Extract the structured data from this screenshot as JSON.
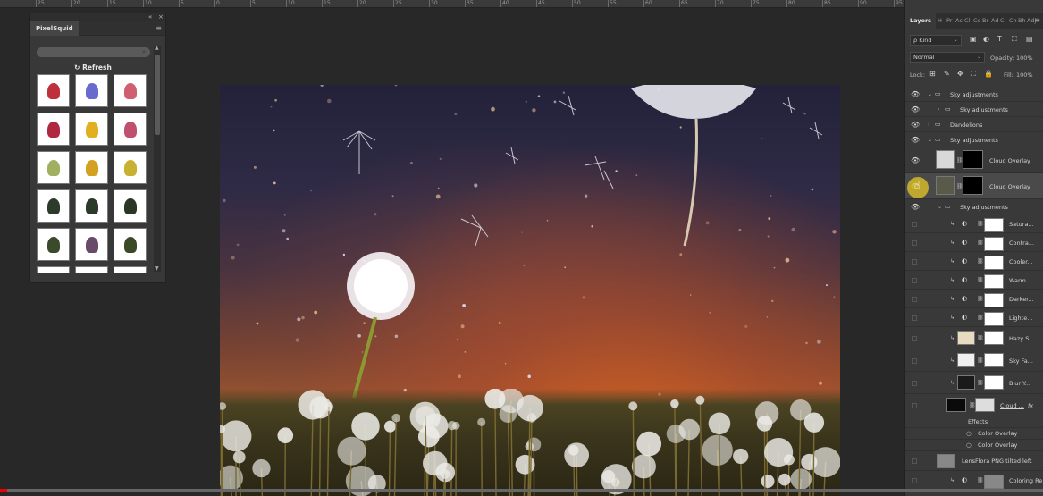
{
  "ruler": {
    "labels": [
      "25",
      "20",
      "15",
      "10",
      "5",
      "0",
      "5",
      "10",
      "15",
      "20",
      "25",
      "30",
      "35",
      "40",
      "45",
      "50",
      "55",
      "60",
      "65",
      "70",
      "75",
      "80",
      "85",
      "90",
      "95",
      "100"
    ]
  },
  "pixelsquid": {
    "tab": "PixelSquid",
    "collapse_icon": "double-chevron-icon",
    "close_glyph": "×",
    "menu_glyph": "≡",
    "search_glyph": "⌕",
    "refresh_label": "Refresh",
    "refresh_icon": "refresh-icon",
    "thumbnails": [
      {
        "name": "red-rose",
        "color": "#c0303a"
      },
      {
        "name": "blue-flower",
        "color": "#6a6acc"
      },
      {
        "name": "pink-flower",
        "color": "#d06070"
      },
      {
        "name": "red-flowers",
        "color": "#b02840"
      },
      {
        "name": "yellow-flower",
        "color": "#e0b020"
      },
      {
        "name": "pink-branch",
        "color": "#c05070"
      },
      {
        "name": "white-flower",
        "color": "#a0b060"
      },
      {
        "name": "sunflowers",
        "color": "#d4a020"
      },
      {
        "name": "yellow-branch",
        "color": "#c8b030"
      },
      {
        "name": "tree-1",
        "color": "#2e3a2a"
      },
      {
        "name": "tree-2",
        "color": "#2c3a28"
      },
      {
        "name": "tree-3",
        "color": "#2a3626"
      },
      {
        "name": "shrub",
        "color": "#3a4a2a"
      },
      {
        "name": "purple-shrub",
        "color": "#6a4a6a"
      },
      {
        "name": "grass-tuft",
        "color": "#3a4a28"
      },
      {
        "name": "more-1",
        "color": "#555555"
      },
      {
        "name": "more-2",
        "color": "#c08040"
      },
      {
        "name": "more-3",
        "color": "#555555"
      }
    ]
  },
  "panel": {
    "tabs": [
      "Layers",
      "H",
      "Pr",
      "Ac",
      "Cl",
      "Cc",
      "Br",
      "Ad",
      "Cl",
      "Ch",
      "Bh",
      "Adj"
    ],
    "menu_glyph": "≡",
    "filter_kind": "ρ Kind",
    "blend_mode": "Normal",
    "opacity_label": "Opacity:",
    "opacity_value": "100%",
    "lock_label": "Lock:",
    "fill_label": "Fill:",
    "fill_value": "100%",
    "caret": "⌄"
  },
  "layers": [
    {
      "name": "Sky adjustments",
      "kind": "group",
      "indent": 0,
      "expanded": true,
      "visible": true
    },
    {
      "name": "Sky adjustments",
      "kind": "group",
      "indent": 1,
      "expanded": false,
      "visible": true
    },
    {
      "name": "Dandelions",
      "kind": "group",
      "indent": 0,
      "expanded": false,
      "visible": true
    },
    {
      "name": "Sky adjustments",
      "kind": "group",
      "indent": 0,
      "expanded": true,
      "visible": true
    },
    {
      "name": "Cloud Overlay",
      "kind": "layer-mask",
      "indent": 1,
      "visible": true,
      "thumb": "#d8d8d8",
      "mask": "#000000"
    },
    {
      "name": "Cloud Overlay",
      "kind": "layer-mask",
      "indent": 1,
      "visible": true,
      "selected": true,
      "thumb": "#5a5a4a",
      "mask": "#000000"
    },
    {
      "name": "Sky adjustments",
      "kind": "group",
      "indent": 1,
      "expanded": true,
      "visible": true
    },
    {
      "name": "Satura...",
      "kind": "adjust",
      "visible": false,
      "mask": "#ffffff"
    },
    {
      "name": "Contra...",
      "kind": "adjust",
      "visible": false,
      "mask": "#ffffff"
    },
    {
      "name": "Cooler...",
      "kind": "adjust",
      "visible": false,
      "mask": "#ffffff"
    },
    {
      "name": "Warm...",
      "kind": "adjust",
      "visible": false,
      "mask": "#ffffff"
    },
    {
      "name": "Darker...",
      "kind": "adjust",
      "visible": false,
      "mask": "#ffffff"
    },
    {
      "name": "Lighte...",
      "kind": "adjust",
      "visible": false,
      "mask": "#ffffff"
    },
    {
      "name": "Hazy S...",
      "kind": "fill",
      "visible": false,
      "thumb": "#e8dcc0",
      "mask": "#ffffff"
    },
    {
      "name": "Sky Fa...",
      "kind": "fill",
      "visible": false,
      "thumb": "#f0f0f0",
      "mask": "#ffffff"
    },
    {
      "name": "Blur Y...",
      "kind": "fill",
      "visible": false,
      "thumb": "#1a1a1a",
      "mask": "#ffffff"
    },
    {
      "name": "Cloud ...",
      "kind": "fx",
      "visible": false,
      "thumb": "#0a0a0a",
      "mask": "#dddddd",
      "fx": "fx"
    },
    {
      "name": "Effects",
      "kind": "effects-header",
      "visible": false
    },
    {
      "name": "Color Overlay",
      "kind": "effect",
      "visible": false
    },
    {
      "name": "Color Overlay",
      "kind": "effect",
      "visible": false
    },
    {
      "name": "LensFlora PNG tilted left",
      "kind": "image",
      "visible": false,
      "thumb": "#888888"
    },
    {
      "name": "Coloring Re...",
      "kind": "adjust",
      "visible": false,
      "mask": "#888888"
    }
  ],
  "video": {
    "progress": 0.007
  }
}
